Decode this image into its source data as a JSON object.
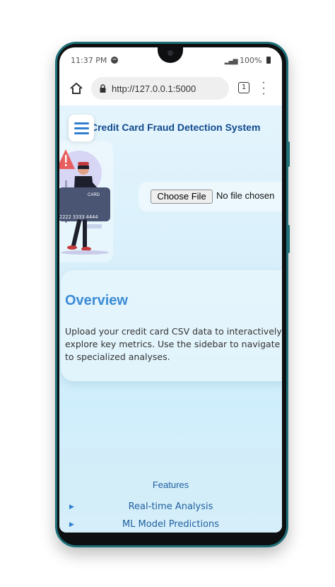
{
  "status": {
    "time": "11:37 PM",
    "battery": "100%"
  },
  "browser": {
    "url": "http://127.0.0.1:5000",
    "tab_count": "1"
  },
  "header": {
    "title": "Credit Card Fraud Detection System"
  },
  "card_illustration": {
    "card_label": "CARD",
    "card_number": "2222  3333  4444"
  },
  "upload": {
    "button_label": "Choose File",
    "status_text": "No file chosen"
  },
  "overview": {
    "title": "Overview",
    "lines": [
      "Upload your credit card CSV data to interactively",
      "explore key metrics. Use the sidebar to navigate",
      "to specialized analyses."
    ]
  },
  "features": {
    "heading": "Features",
    "items": [
      "Real-time Analysis",
      "ML Model Predictions"
    ]
  }
}
